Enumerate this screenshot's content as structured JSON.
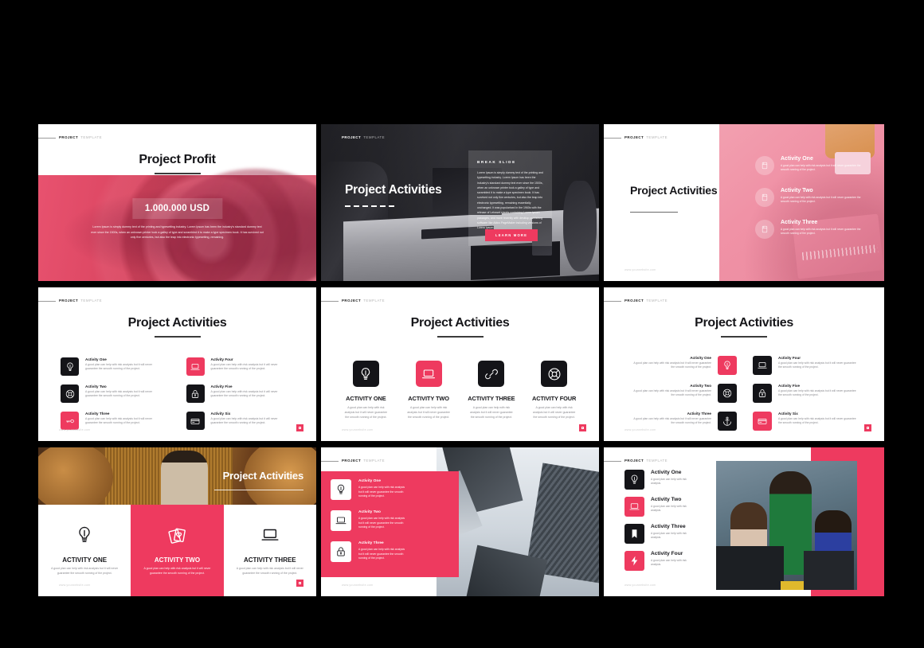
{
  "brand": {
    "bold": "PROJECT",
    "light": "TEMPLATE"
  },
  "watermark": "www.yourwebsite.com",
  "accent_color": "#ee3a5f",
  "dark_color": "#141418",
  "desc_short": "A good plan can help with risk analysis.",
  "desc_medium": "A good plan can help with risk analysis but it will never guarantee the smooth running of the project.",
  "desc_long": "A good plan can help with risk analysis but it will never guarantee the smooth running of the project.",
  "desc_card": "A good plan can help with risk analysis but it will never guarantee the smooth running of the project.",
  "slide1": {
    "title": "Project Profit",
    "amount": "1.000.000 USD",
    "lead": "Lorem Ipsum is simply dummy text of the printing and typesetting industry. Lorem Ipsum has been the industry's standard dummy text ever since the 1500s, when an unknown printer took a galley of type and scrambled it to make a type specimen book. It has survived not only five centuries, but also the leap into electronic typesetting, remaining."
  },
  "slide2": {
    "title": "Project Activities",
    "kicker": "BREAK SLIDE",
    "body": "Lorem Ipsum is simply dummy text of the printing and typesetting industry. Lorem Ipsum has been the industry's standard dummy text ever since the 1500s, when an unknown printer took a galley of type and scrambled it to make a type specimen book. It has survived not only five centuries, but also the leap into electronic typesetting, remaining essentially unchanged. It was popularised in the 1960s with the release of Letraset sheets containing Lorem Ipsum passages, and more recently with desktop publishing software like Aldus PageMaker including versions of Lorem Ipsum.",
    "cta": "LEARN MORE"
  },
  "slide3": {
    "title": "Project Activities",
    "items": [
      {
        "name": "Activity One",
        "icon": "note-icon"
      },
      {
        "name": "Activity Two",
        "icon": "note-icon"
      },
      {
        "name": "Activity Three",
        "icon": "note-icon"
      }
    ]
  },
  "slide4": {
    "title": "Project Activities",
    "items": [
      {
        "name": "Activity One",
        "icon": "lightbulb-icon",
        "tone": "dark"
      },
      {
        "name": "Activity Four",
        "icon": "laptop-icon",
        "tone": "pink"
      },
      {
        "name": "Activity Two",
        "icon": "lifebuoy-icon",
        "tone": "dark"
      },
      {
        "name": "Activity Five",
        "icon": "lock-icon",
        "tone": "dark"
      },
      {
        "name": "Activity Three",
        "icon": "key-icon",
        "tone": "pink"
      },
      {
        "name": "Activity Six",
        "icon": "card-icon",
        "tone": "dark"
      }
    ]
  },
  "slide5": {
    "title": "Project Activities",
    "cards": [
      {
        "name": "ACTIVITY ONE",
        "icon": "lightbulb-icon",
        "tone": "dark"
      },
      {
        "name": "ACTIVITY TWO",
        "icon": "laptop-icon",
        "tone": "pink"
      },
      {
        "name": "ACTIVITY THREE",
        "icon": "link-icon",
        "tone": "dark"
      },
      {
        "name": "ACTIVITY FOUR",
        "icon": "lifebuoy-icon",
        "tone": "dark"
      }
    ],
    "card_desc": "A good plan can help with risk analysis but it will never guarantee the smooth running of the project."
  },
  "slide6": {
    "title": "Project Activities",
    "items": [
      {
        "name": "Activity One",
        "icon": "lightbulb-icon",
        "tone": "pink"
      },
      {
        "name": "Activity Four",
        "icon": "laptop-icon",
        "tone": "dark"
      },
      {
        "name": "Activity Two",
        "icon": "lifebuoy-icon",
        "tone": "dark"
      },
      {
        "name": "Activity Five",
        "icon": "lock-icon",
        "tone": "dark"
      },
      {
        "name": "Activity Three",
        "icon": "anchor-icon",
        "tone": "dark"
      },
      {
        "name": "Activity Six",
        "icon": "card-icon",
        "tone": "pink"
      }
    ]
  },
  "slide7": {
    "title": "Project Activities",
    "cards": [
      {
        "name": "ACTIVITY ONE",
        "icon": "lightbulb-icon",
        "tone": "plain"
      },
      {
        "name": "ACTIVITY TWO",
        "icon": "cards-icon",
        "tone": "pink"
      },
      {
        "name": "ACTIVITY THREE",
        "icon": "laptop-icon",
        "tone": "plain"
      }
    ],
    "card_desc": "A good plan can help with risk analysis but it will never guarantee the smooth running of the project."
  },
  "slide8": {
    "items": [
      {
        "name": "Activity One",
        "icon": "lightbulb-icon"
      },
      {
        "name": "Activity Two",
        "icon": "laptop-icon"
      },
      {
        "name": "Activity Three",
        "icon": "lock-icon"
      }
    ]
  },
  "slide9": {
    "items": [
      {
        "name": "Activity One",
        "icon": "lightbulb-icon",
        "tone": "dark"
      },
      {
        "name": "Activity Two",
        "icon": "laptop-icon",
        "tone": "pink"
      },
      {
        "name": "Activity Three",
        "icon": "bookmark-icon",
        "tone": "dark"
      },
      {
        "name": "Activity Four",
        "icon": "bolt-icon",
        "tone": "pink"
      }
    ]
  }
}
